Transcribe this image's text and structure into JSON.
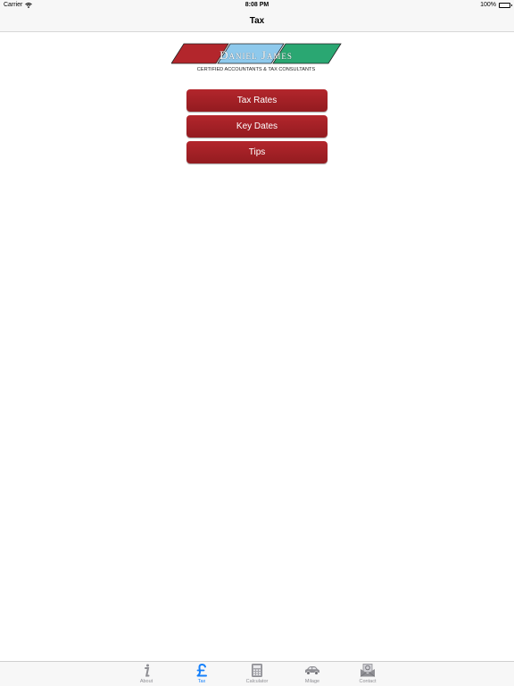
{
  "status_bar": {
    "carrier": "Carrier",
    "time": "8:08 PM",
    "battery": "100%",
    "battery_level": 1.0
  },
  "nav": {
    "title": "Tax"
  },
  "logo": {
    "name": "Daniel James",
    "tagline": "CERTIFIED ACCOUNTANTS & TAX CONSULTANTS",
    "colors": [
      "#b3262c",
      "#8ec9ec",
      "#2aa772"
    ]
  },
  "menu": {
    "items": [
      "Tax Rates",
      "Key Dates",
      "Tips"
    ]
  },
  "tab_bar": {
    "active_color": "#1580fb",
    "items": [
      {
        "label": "About",
        "icon": "info-icon"
      },
      {
        "label": "Tax",
        "icon": "pound-icon",
        "active": true
      },
      {
        "label": "Calculator",
        "icon": "calculator-icon"
      },
      {
        "label": "Milage",
        "icon": "car-icon"
      },
      {
        "label": "Contact",
        "icon": "envelope-icon"
      }
    ]
  }
}
